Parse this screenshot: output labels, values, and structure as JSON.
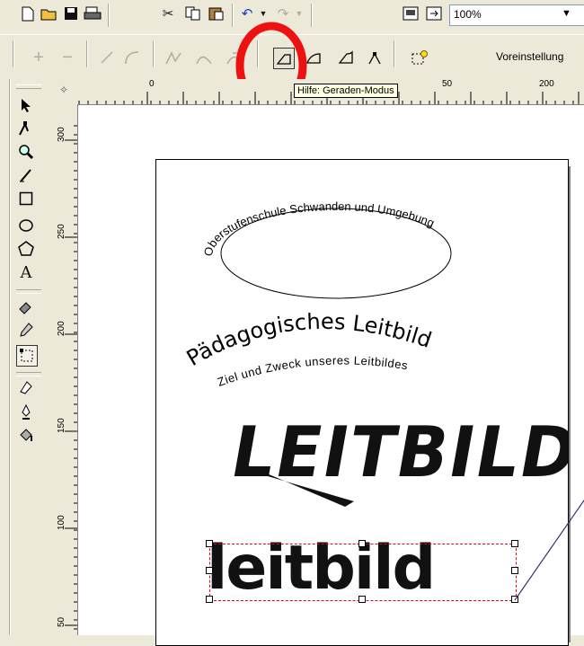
{
  "toolbar1": {
    "zoom_value": "100%"
  },
  "toolbar2": {
    "preset_label": "Voreinstellung"
  },
  "tooltip": {
    "text": "Hilfe: Geraden-Modus"
  },
  "ruler": {
    "h_ticks": [
      "0",
      "50",
      "200"
    ],
    "v_ticks": [
      "300",
      "250",
      "200",
      "150",
      "100",
      "50"
    ]
  },
  "document": {
    "arc_text": "Oberstufenschule Schwanden und Umgebung",
    "heading": "Pädagogisches Leitbild",
    "subheading": "Ziel und Zweck unseres Leitbildes",
    "big_title": "LEITBILD",
    "bold_word": "leitbild"
  },
  "colors": {
    "highlight_circle": "#ee1111",
    "selection_dash": "#e8001c",
    "connector_line": "#333377"
  },
  "icons": {
    "toolbar1": [
      "new-icon",
      "open-icon",
      "save-icon",
      "print-icon",
      "cut-icon",
      "copy-icon",
      "paste-icon",
      "undo-icon",
      "redo-icon",
      "import-icon",
      "export-icon"
    ],
    "toolbar2": [
      "add-node-icon",
      "delete-node-icon",
      "to-line-icon",
      "to-curve-icon",
      "cusp-node-icon",
      "smooth-node-icon",
      "symmetric-node-icon",
      "line-mode-icon",
      "curve-mode-icon",
      "auto-mode-icon",
      "node-tool-icon",
      "select-all-nodes-icon"
    ],
    "tools": [
      "pick-tool-icon",
      "shape-tool-icon",
      "zoom-tool-icon",
      "freehand-tool-icon",
      "rectangle-tool-icon",
      "ellipse-tool-icon",
      "polygon-tool-icon",
      "text-tool-icon",
      "interactive-fill-icon",
      "eyedropper-tool-icon",
      "node-edit-icon",
      "outline-tool-icon",
      "pen-tool-icon",
      "fill-bucket-icon"
    ]
  }
}
